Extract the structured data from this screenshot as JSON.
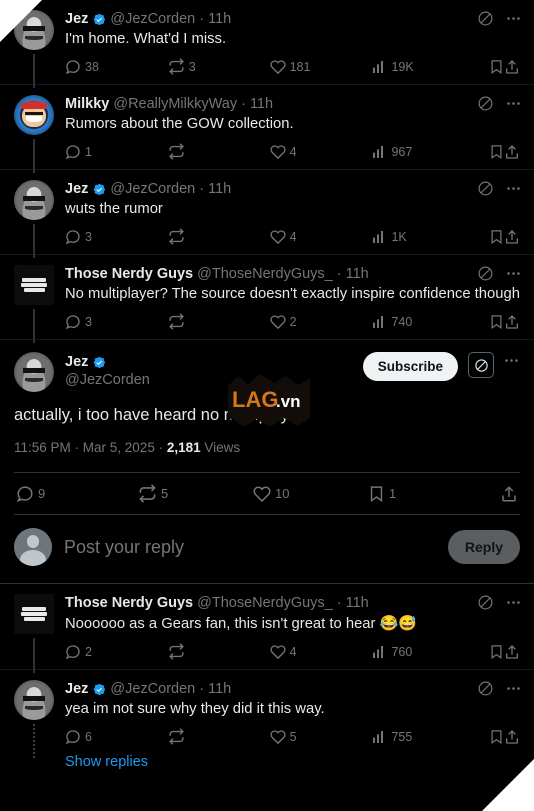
{
  "theme": {
    "background": "#000000",
    "text_primary": "#e7e9ea",
    "text_secondary": "#71767b",
    "accent_blue": "#1d9bf0",
    "verified_blue": "#1d9bf0",
    "border": "#2f3336",
    "subscribe_bg": "#eff3f4",
    "reply_button_bg": "#5b5e61",
    "watermark_orange": "#d4761a"
  },
  "watermark": {
    "brand": "LAG",
    "tld": ".vn"
  },
  "thread": {
    "tweets": [
      {
        "display_name": "Jez",
        "verified": true,
        "handle": "@JezCorden",
        "time": "11h",
        "text": "I'm home. What'd I miss.",
        "avatar": "jez-avatar",
        "replies": "38",
        "retweets": "3",
        "likes": "181",
        "views": "19K",
        "grok_icon": "grok-icon",
        "more_icon": "more-options-icon"
      },
      {
        "display_name": "Milkky",
        "verified": false,
        "handle": "@ReallyMilkkyWay",
        "time": "11h",
        "text": "Rumors about the GOW collection.",
        "avatar": "milkky-avatar",
        "replies": "1",
        "retweets": "",
        "likes": "4",
        "views": "967",
        "grok_icon": "grok-icon",
        "more_icon": "more-options-icon"
      },
      {
        "display_name": "Jez",
        "verified": true,
        "handle": "@JezCorden",
        "time": "11h",
        "text": "wuts the rumor",
        "avatar": "jez-avatar",
        "replies": "3",
        "retweets": "",
        "likes": "4",
        "views": "1K",
        "grok_icon": "grok-icon",
        "more_icon": "more-options-icon"
      },
      {
        "display_name": "Those Nerdy Guys",
        "verified": false,
        "handle": "@ThoseNerdyGuys_",
        "time": "11h",
        "text": "No multiplayer? The source doesn't exactly inspire confidence though",
        "avatar": "those-nerdy-guys-avatar",
        "replies": "3",
        "retweets": "",
        "likes": "2",
        "views": "740",
        "grok_icon": "grok-icon",
        "more_icon": "more-options-icon"
      }
    ]
  },
  "focused_tweet": {
    "display_name": "Jez",
    "verified": true,
    "handle": "@JezCorden",
    "text": "actually, i too have heard no multiplayer",
    "subscribe_label": "Subscribe",
    "timestamp": "11:56 PM · Mar 5, 2025 · ",
    "views_count": "2,181",
    "views_label": " Views",
    "replies": "9",
    "retweets": "5",
    "likes": "10",
    "bookmarks": "1"
  },
  "composer": {
    "placeholder": "Post your reply",
    "button_label": "Reply"
  },
  "replies": [
    {
      "display_name": "Those Nerdy Guys",
      "verified": false,
      "handle": "@ThoseNerdyGuys_",
      "time": "11h",
      "text": "Noooooo as a Gears fan, this isn't great to hear ",
      "emoji": "😂😅",
      "avatar": "those-nerdy-guys-avatar",
      "replies": "2",
      "retweets": "",
      "likes": "4",
      "views": "760"
    },
    {
      "display_name": "Jez",
      "verified": true,
      "handle": "@JezCorden",
      "time": "11h",
      "text": "yea im not sure why they did it this way.",
      "emoji": "",
      "avatar": "jez-avatar",
      "replies": "6",
      "retweets": "",
      "likes": "5",
      "views": "755"
    }
  ],
  "show_replies_label": "Show replies"
}
